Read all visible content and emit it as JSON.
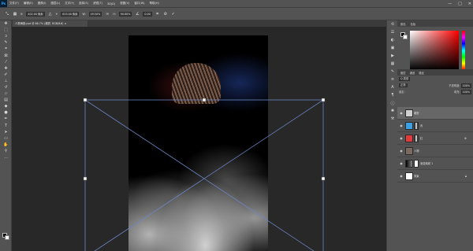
{
  "menubar": {
    "logo": "Ps",
    "items": [
      "文件(F)",
      "编辑(E)",
      "图像(I)",
      "图层(L)",
      "文字(Y)",
      "选择(S)",
      "滤镜(T)",
      "3D(D)",
      "视图(V)",
      "窗口(W)",
      "帮助(H)"
    ],
    "window_controls": [
      "—",
      "□",
      "✕"
    ]
  },
  "optionsbar": {
    "x_label": "X:",
    "x_value": "402.00 像素",
    "y_label": "Y:",
    "y_value": "615.00 像素",
    "w_label": "W:",
    "w_value": "49.50%",
    "h_label": "H:",
    "h_value": "90.80%",
    "angle_value": "0.00",
    "cancel_icon": "cancel-icon",
    "commit_icon": "commit-check-icon"
  },
  "document": {
    "tab_title": "人物海报.psd @ 66.7% (烟雾, RGB/8#) ×",
    "colors": {
      "canvas_bg": "#000000",
      "workspace": "#282828",
      "transform_lines": "#6b86c4"
    }
  },
  "color_panel": {
    "tabs": [
      "颜色",
      "色板"
    ],
    "foreground": "#000000",
    "background": "#ffffff"
  },
  "layers_panel": {
    "tabs": [
      "图层",
      "通道",
      "路径"
    ],
    "filter_label": "Q 类型",
    "blend_mode": "正常",
    "opacity_label": "不透明度:",
    "opacity_value": "100%",
    "lock_label": "锁定:",
    "fill_label": "填充:",
    "fill_value": "100%",
    "layers": [
      {
        "name": "烟雾",
        "selected": true,
        "thumb": "#cfcfcf",
        "mask": null
      },
      {
        "name": "青",
        "selected": false,
        "thumb": "#3aa0e8",
        "mask": "#000000"
      },
      {
        "name": "红",
        "selected": false,
        "thumb": "#e23a3a",
        "mask": "#000000"
      },
      {
        "name": "人物",
        "selected": false,
        "thumb": "#7a6a60",
        "mask": null
      },
      {
        "name": "渐变映射 1",
        "selected": false,
        "thumb": "#2a2a2a",
        "mask": "#ffffff"
      },
      {
        "name": "背景",
        "selected": false,
        "thumb": "#ffffff",
        "mask": null
      }
    ]
  }
}
